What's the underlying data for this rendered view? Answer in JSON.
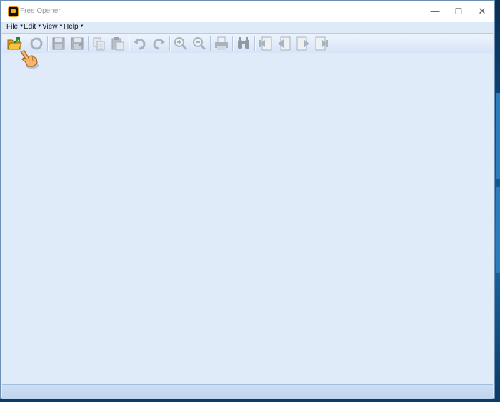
{
  "window": {
    "title": "Free Opener"
  },
  "window_controls": {
    "minimize": "—",
    "maximize": "☐",
    "close": "✕"
  },
  "menu": [
    {
      "label": "File"
    },
    {
      "label": "Edit"
    },
    {
      "label": "View"
    },
    {
      "label": "Help"
    }
  ],
  "toolbar": [
    {
      "icon": "open-folder-icon",
      "enabled": true
    },
    {
      "icon": "refresh-icon",
      "enabled": false
    },
    {
      "icon": "save-icon",
      "enabled": false
    },
    {
      "icon": "save-as-icon",
      "enabled": false
    },
    {
      "icon": "copy-icon",
      "enabled": false
    },
    {
      "icon": "paste-icon",
      "enabled": false
    },
    {
      "icon": "undo-icon",
      "enabled": false
    },
    {
      "icon": "redo-icon",
      "enabled": false
    },
    {
      "icon": "zoom-in-icon",
      "enabled": false
    },
    {
      "icon": "zoom-out-icon",
      "enabled": false
    },
    {
      "icon": "print-icon",
      "enabled": false
    },
    {
      "icon": "find-icon",
      "enabled": false
    },
    {
      "icon": "first-page-icon",
      "enabled": false
    },
    {
      "icon": "previous-page-icon",
      "enabled": false
    },
    {
      "icon": "next-page-icon",
      "enabled": false
    },
    {
      "icon": "last-page-icon",
      "enabled": false
    }
  ],
  "colors": {
    "window_bg": "#dfeaf8",
    "toolbar_disabled_icon": "#a9b3bf",
    "folder_icon": "#f2a81d"
  }
}
